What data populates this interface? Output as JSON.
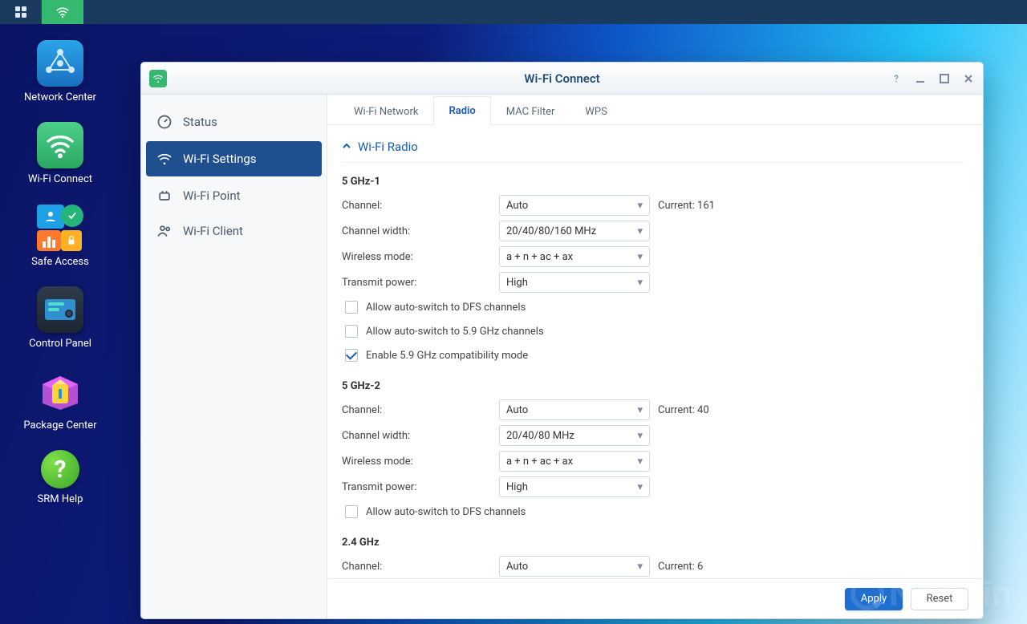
{
  "desktop": {
    "items": [
      {
        "label": "Network Center"
      },
      {
        "label": "Wi-Fi Connect"
      },
      {
        "label": "Safe Access"
      },
      {
        "label": "Control Panel"
      },
      {
        "label": "Package Center"
      },
      {
        "label": "SRM Help"
      }
    ]
  },
  "window": {
    "title": "Wi-Fi Connect",
    "sidebar": {
      "items": [
        {
          "label": "Status"
        },
        {
          "label": "Wi-Fi Settings"
        },
        {
          "label": "Wi-Fi Point"
        },
        {
          "label": "Wi-Fi Client"
        }
      ],
      "active_index": 1
    },
    "tabs": {
      "items": [
        {
          "label": "Wi-Fi Network"
        },
        {
          "label": "Radio"
        },
        {
          "label": "MAC Filter"
        },
        {
          "label": "WPS"
        }
      ],
      "active_index": 1
    },
    "section_title": "Wi-Fi Radio",
    "bands": [
      {
        "title": "5 GHz-1",
        "rows": [
          {
            "label": "Channel:",
            "value": "Auto",
            "aux": "Current: 161"
          },
          {
            "label": "Channel width:",
            "value": "20/40/80/160 MHz"
          },
          {
            "label": "Wireless mode:",
            "value": "a + n + ac + ax"
          },
          {
            "label": "Transmit power:",
            "value": "High"
          }
        ],
        "checks": [
          {
            "label": "Allow auto-switch to DFS channels",
            "checked": false
          },
          {
            "label": "Allow auto-switch to 5.9 GHz channels",
            "checked": false
          },
          {
            "label": "Enable 5.9 GHz compatibility mode",
            "checked": true
          }
        ]
      },
      {
        "title": "5 GHz-2",
        "rows": [
          {
            "label": "Channel:",
            "value": "Auto",
            "aux": "Current: 40"
          },
          {
            "label": "Channel width:",
            "value": "20/40/80 MHz"
          },
          {
            "label": "Wireless mode:",
            "value": "a + n + ac + ax"
          },
          {
            "label": "Transmit power:",
            "value": "High"
          }
        ],
        "checks": [
          {
            "label": "Allow auto-switch to DFS channels",
            "checked": false
          }
        ]
      },
      {
        "title": "2.4 GHz",
        "rows": [
          {
            "label": "Channel:",
            "value": "Auto",
            "aux": "Current: 6"
          }
        ],
        "checks": []
      }
    ],
    "footer": {
      "apply": "Apply",
      "reset": "Reset"
    }
  },
  "watermark": "Neowin"
}
